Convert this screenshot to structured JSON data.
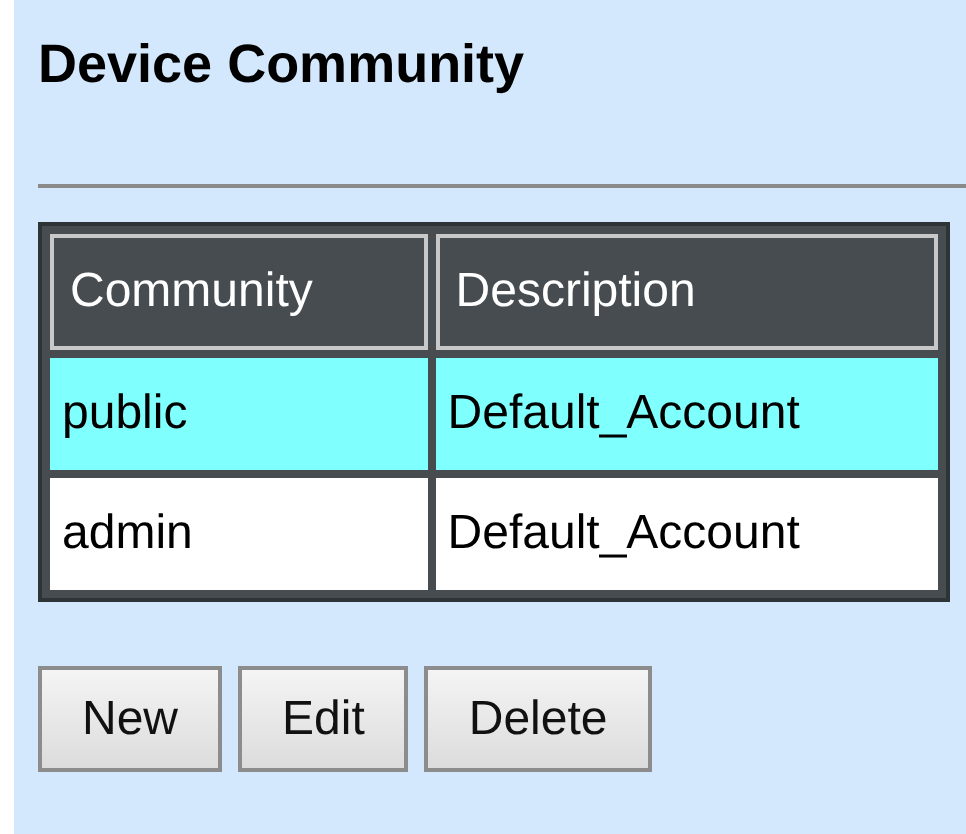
{
  "title": "Device Community",
  "table": {
    "columns": [
      "Community",
      "Description"
    ],
    "rows": [
      {
        "cells": [
          "public",
          "Default_Account"
        ],
        "selected": true
      },
      {
        "cells": [
          "admin",
          "Default_Account"
        ],
        "selected": false
      }
    ]
  },
  "buttons": [
    "New",
    "Edit",
    "Delete"
  ]
}
